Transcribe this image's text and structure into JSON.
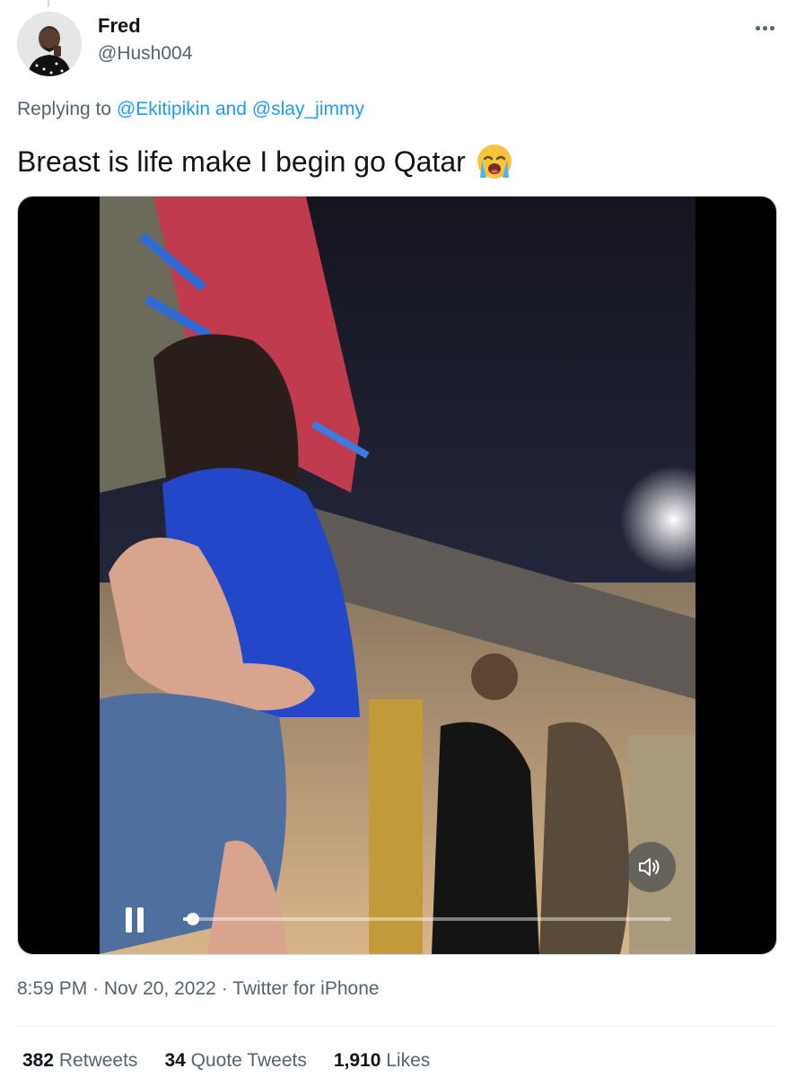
{
  "tweet": {
    "author_name": "Fred",
    "author_handle": "@Hush004",
    "replying_prefix": "Replying to",
    "reply_user_1": "@Ekitipikin",
    "reply_joiner": "and",
    "reply_user_2": "@slay_jimmy",
    "text": "Breast is life make I begin go Qatar",
    "emoji_icon": "loudly-crying-face-emoji",
    "time": "8:59 PM",
    "date": "Nov 20, 2022",
    "source": "Twitter for iPhone",
    "separator": "·"
  },
  "video": {
    "state": "playing",
    "progress": 0.02
  },
  "stats": {
    "retweets_count": "382",
    "retweets_label": "Retweets",
    "quotes_count": "34",
    "quotes_label": "Quote Tweets",
    "likes_count": "1,910",
    "likes_label": "Likes"
  },
  "colors": {
    "link": "#1d9bf0",
    "secondary_text": "#536471",
    "primary_text": "#0f1419",
    "border": "#cfd9de"
  }
}
